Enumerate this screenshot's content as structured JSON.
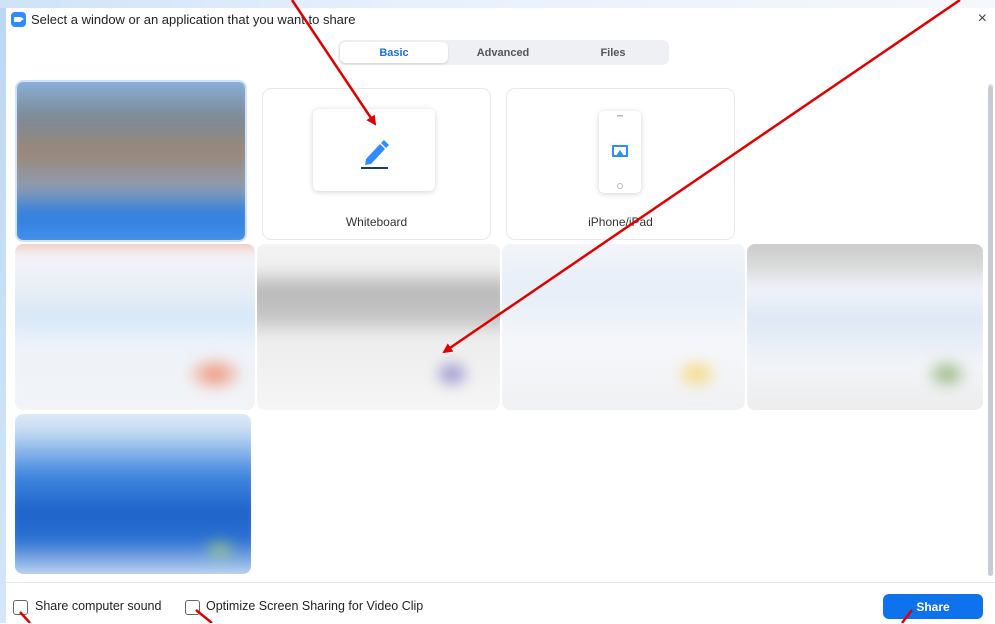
{
  "window": {
    "title": "Select a window or an application that you want to share",
    "close_glyph": "×",
    "icon": "zoom-camera-icon"
  },
  "tabs": [
    {
      "label": "Basic",
      "active": true
    },
    {
      "label": "Advanced",
      "active": false
    },
    {
      "label": "Files",
      "active": false
    }
  ],
  "cards": [
    {
      "label": "Whiteboard",
      "icon": "pencil-icon"
    },
    {
      "label": "iPhone/iPad",
      "icon": "airplay-icon"
    }
  ],
  "footer": {
    "share_sound_label": "Share computer sound",
    "optimize_label": "Optimize Screen Sharing for Video Clip",
    "share_button": "Share"
  },
  "colors": {
    "accent": "#0e72ed",
    "tab_active_text": "#1a6fd8",
    "annotation_arrow": "#e00000"
  }
}
